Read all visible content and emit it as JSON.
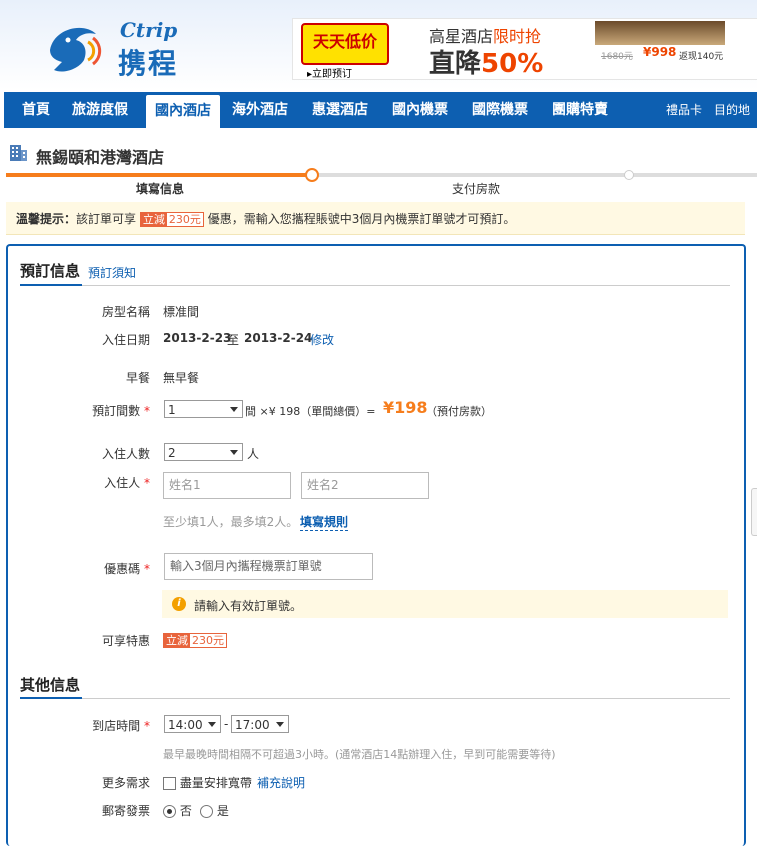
{
  "header": {
    "logo_en": "Ctrip",
    "logo_cn": "携程",
    "banner": {
      "cal_text": "天天低价",
      "link_text": "▸立即预订",
      "line1_a": "高星酒店",
      "line1_b": "限时抢",
      "line2_a": "直降",
      "line2_b": "50%",
      "old_price": "1680元",
      "new_price": "¥998",
      "cashback": "返现140元"
    }
  },
  "nav": {
    "items": [
      "首頁",
      "旅游度假",
      "國內酒店",
      "海外酒店",
      "惠選酒店",
      "國內機票",
      "國際機票",
      "團購特賣"
    ],
    "active": "國內酒店",
    "util_items": [
      "禮品卡",
      "目的地攻"
    ]
  },
  "hotel": {
    "name": "無錫頤和港灣酒店"
  },
  "progress": {
    "step1": "填寫信息",
    "step2": "支付房款"
  },
  "tip": {
    "prefix": "溫馨提示：",
    "text_a": "該訂單可享",
    "text_b": "優惠，需輸入您攜程賬號中3個月內機票訂單號才可預訂。"
  },
  "discount": {
    "label": "立減",
    "amount": "230元"
  },
  "booking": {
    "section_title": "預訂信息",
    "notice_link": "預訂須知",
    "room_type_label": "房型名稱",
    "room_type_value": "標准間",
    "dates_label": "入住日期",
    "checkin": "2013-2-23",
    "to": "至",
    "checkout": "2013-2-24",
    "edit_link": "修改",
    "breakfast_label": "早餐",
    "breakfast_value": "無早餐",
    "rooms_label": "預訂間數",
    "rooms_value": "1",
    "rooms_calc": "間 ×¥ 198（單間總價）=",
    "total_price": "¥198",
    "prepay_note": "（預付房款）",
    "guests_label": "入住人數",
    "guests_value": "2",
    "guests_unit": "人",
    "occupant_label": "入住人",
    "name1_placeholder": "姓名1",
    "name2_placeholder": "姓名2",
    "occupant_hint": "至少填1人，最多填2人。",
    "fill_rules_link": "填寫規則",
    "coupon_label": "優惠碼",
    "coupon_placeholder": "輸入3個月內攜程機票訂單號",
    "warn_text": "請輸入有效訂單號。",
    "benefit_label": "可享特惠"
  },
  "other": {
    "section_title": "其他信息",
    "arrival_label": "到店時間",
    "arrival_from": "14:00",
    "dash": "-",
    "arrival_to": "17:00",
    "arrival_hint": "最早最晚時間相隔不可超過3小時。(通常酒店14點辦理入住，早到可能需要等待)",
    "more_label": "更多需求",
    "more_option": "盡量安排寬帶",
    "more_link": "補充說明",
    "invoice_label": "郵寄發票",
    "invoice_no": "否",
    "invoice_yes": "是"
  }
}
